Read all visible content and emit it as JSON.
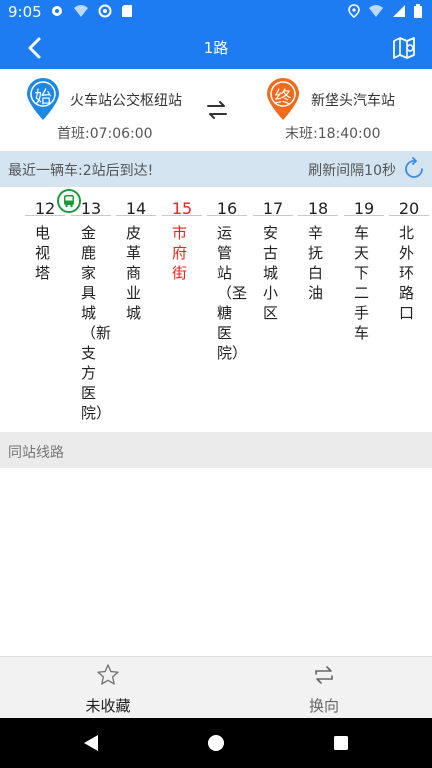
{
  "status_bar": {
    "time": "9:05",
    "icons": [
      "settings-icon",
      "wifi-question-icon",
      "circle-icon",
      "sd-card-icon",
      "location-icon",
      "wifi-icon",
      "signal-icon",
      "battery-icon"
    ]
  },
  "app_bar": {
    "title": "1路"
  },
  "route": {
    "start": {
      "badge": "始",
      "name": "火车站公交枢纽站",
      "time_label": "首班:07:06:00",
      "color": "#1e88e5"
    },
    "end": {
      "badge": "终",
      "name": "新垡头汽车站",
      "time_label": "末班:18:40:00",
      "color": "#f26a1b"
    }
  },
  "info_bar": {
    "arrival_text": "最近一辆车:2站后到达!",
    "refresh_text": "刷新间隔10秒"
  },
  "stops": [
    {
      "num": "12",
      "name": "电视塔"
    },
    {
      "num": "13",
      "name": "金鹿家具城（新支方医院）"
    },
    {
      "num": "14",
      "name": "皮革商业城"
    },
    {
      "num": "15",
      "name": "市府街",
      "current": true
    },
    {
      "num": "16",
      "name": "运管站（圣糖医院）"
    },
    {
      "num": "17",
      "name": "安古城小区"
    },
    {
      "num": "18",
      "name": "辛抚白油"
    },
    {
      "num": "19",
      "name": "车天下二手车"
    },
    {
      "num": "20",
      "name": "北外环路口"
    }
  ],
  "section": {
    "title": "同站线路"
  },
  "bottom_nav": {
    "favorite_label": "未收藏",
    "reverse_label": "换向"
  },
  "colors": {
    "primary": "#1e7cf2",
    "current_stop": "#e8251c",
    "bus": "#1d9a3a"
  }
}
